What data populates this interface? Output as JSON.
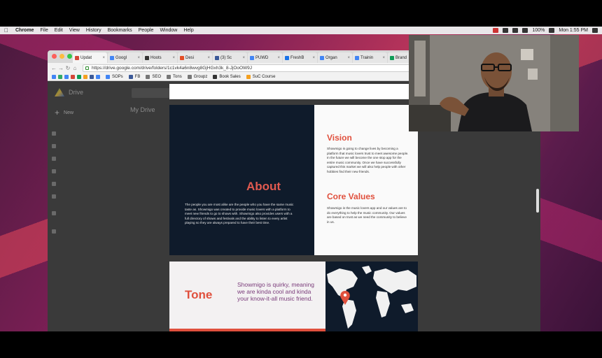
{
  "menubar": {
    "items": [
      "Chrome",
      "File",
      "Edit",
      "View",
      "History",
      "Bookmarks",
      "People",
      "Window",
      "Help"
    ],
    "battery": "100%",
    "clock": "Mon 1:55 PM"
  },
  "tabs": [
    {
      "label": "Updat",
      "color": "#d44638"
    },
    {
      "label": "Googl",
      "color": "#4285f4"
    },
    {
      "label": "Hoots",
      "color": "#333333"
    },
    {
      "label": "Desi",
      "color": "#e34f26"
    },
    {
      "label": "(3) Sc",
      "color": "#3b5998"
    },
    {
      "label": "PUWD",
      "color": "#4285f4"
    },
    {
      "label": "FreshB",
      "color": "#1a73e8"
    },
    {
      "label": "Organ",
      "color": "#4285f4"
    },
    {
      "label": "Trainin",
      "color": "#4285f4"
    },
    {
      "label": "Brand",
      "color": "#0f9d58"
    }
  ],
  "address": {
    "url": "https://drive.google.com/drive/folders/1c1vk4a6n8wvg8GjHGxh3k_8-JjOoOW9J"
  },
  "bookmarks": [
    {
      "label": "SOPs",
      "color": "#4285f4"
    },
    {
      "label": "FB",
      "color": "#3b5998"
    },
    {
      "label": "SEO",
      "color": "#777777"
    },
    {
      "label": "Tons",
      "color": "#777777"
    },
    {
      "label": "Groupz",
      "color": "#777777"
    },
    {
      "label": "Book Sales",
      "color": "#333333"
    },
    {
      "label": "SuC Course",
      "color": "#f4a020"
    }
  ],
  "drive": {
    "logo": "Drive",
    "new": "New",
    "heading": "My Drive"
  },
  "slide_about": {
    "title": "About",
    "body": "The people you are most alike are the people who you have the same music taste as. Showmigo was created to provide music lovers with a platform to meet new friends to go to shows with. Showmigo also provides users with a full directory of shows and festivals and the ability to listen to every artist playing so they are always prepared to have their best time."
  },
  "slide_vision": {
    "title": "Vision",
    "body": "Showmigo is going to change lives by becoming a platform that music lovers trust to meet awesome people. In the future we will become the one stop app for the entire music community. Once we have successfully captured this market we will also help people with other hobbies find their new friends."
  },
  "slide_core": {
    "title": "Core Values",
    "body": "Showmigo is the music lovers app and our values are to do everything to help the music community. Our values are based on trust as we need the community to believe in us."
  },
  "slide_tone": {
    "title": "Tone",
    "body": "Showmigo is quirky, meaning we are kinda cool and kinda your know-it-all music friend."
  },
  "colors": {
    "accent": "#e0503d",
    "navy": "#0f1b2b",
    "purple": "#7a3b7a"
  }
}
